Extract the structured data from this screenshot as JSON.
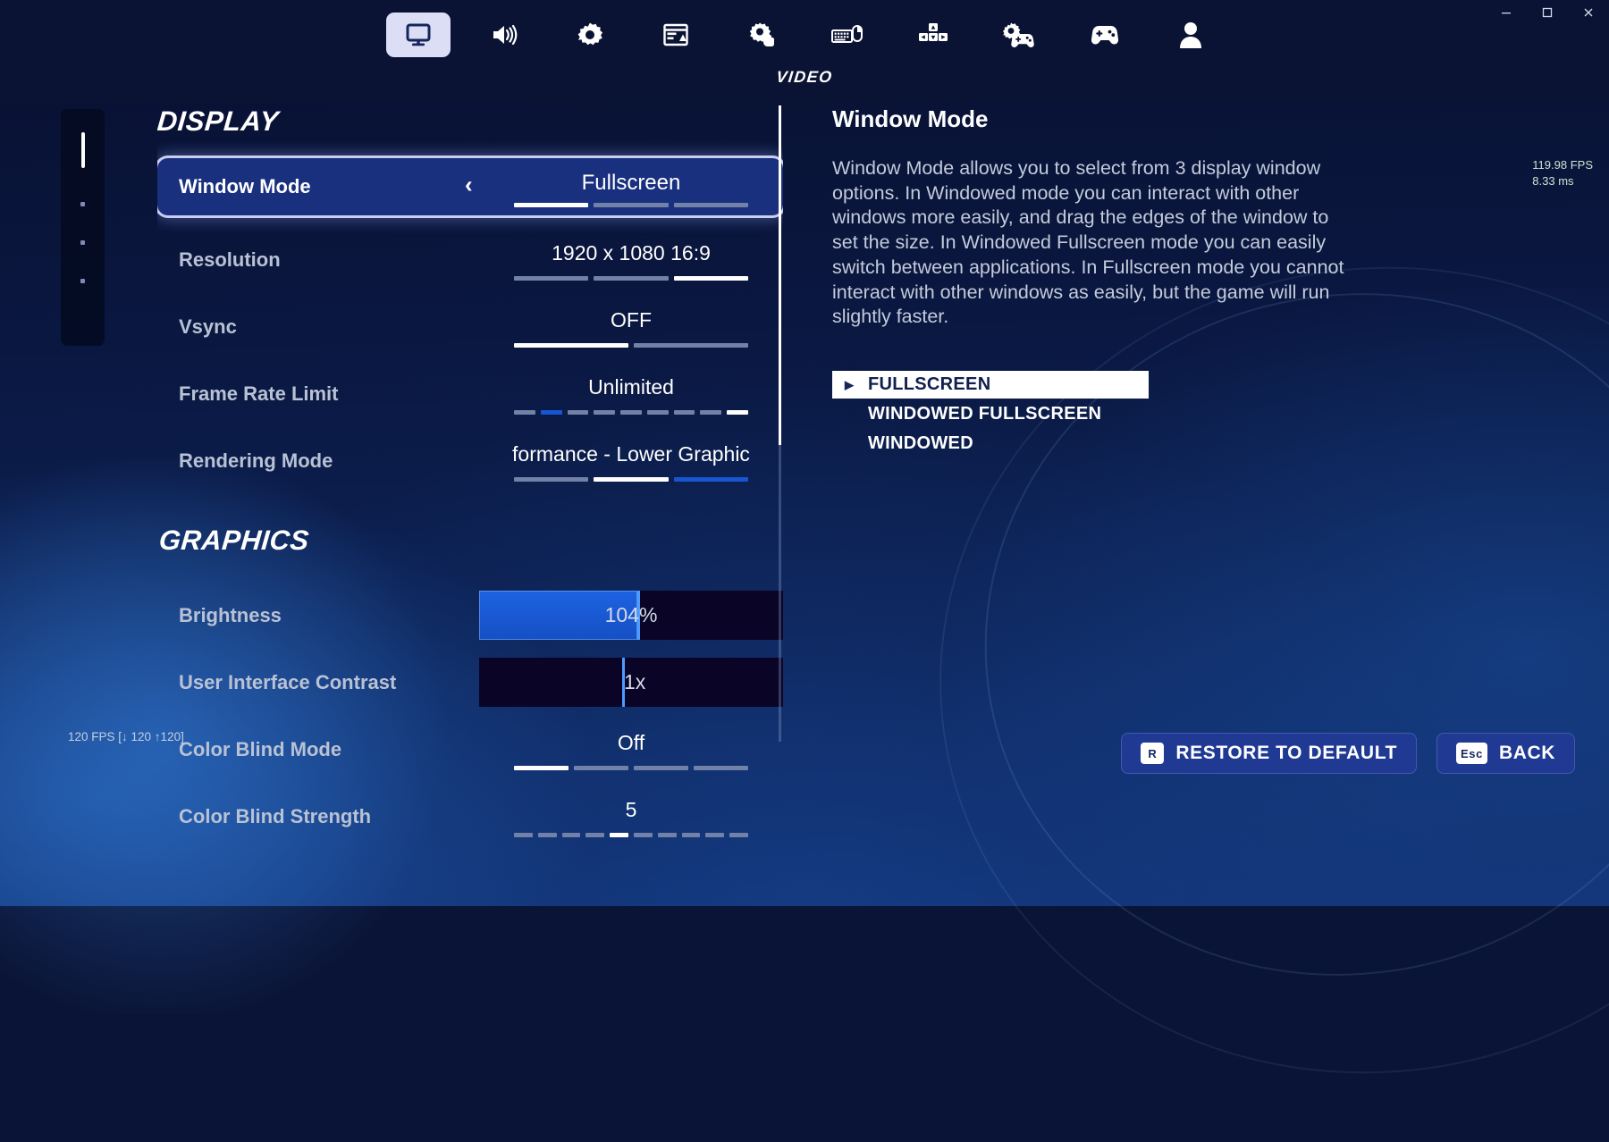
{
  "window_controls": {
    "minimize": "minimize",
    "maximize": "maximize",
    "close": "close"
  },
  "tabs": [
    {
      "icon": "monitor-icon",
      "name": "video",
      "active": true
    },
    {
      "icon": "speaker-icon",
      "name": "audio",
      "active": false
    },
    {
      "icon": "gear-icon",
      "name": "game",
      "active": false
    },
    {
      "icon": "hud-layout-icon",
      "name": "hud-layout",
      "active": false
    },
    {
      "icon": "accessibility-touch-icon",
      "name": "accessibility",
      "active": false
    },
    {
      "icon": "keyboard-mouse-icon",
      "name": "keyboard-mouse",
      "active": false
    },
    {
      "icon": "dpad-keys-icon",
      "name": "input-keys",
      "active": false
    },
    {
      "icon": "controller-gear-icon",
      "name": "controller-settings",
      "active": false
    },
    {
      "icon": "controller-icon",
      "name": "controller",
      "active": false
    },
    {
      "icon": "account-icon",
      "name": "account",
      "active": false
    }
  ],
  "active_tab_label": "VIDEO",
  "sections": [
    {
      "heading": "DISPLAY",
      "rows": [
        {
          "label": "Window Mode",
          "value": "Fullscreen",
          "type": "stepper",
          "selected": true,
          "segments": 3,
          "active_segment": 0,
          "left_arrow": "‹",
          "right_arrow": "›"
        },
        {
          "label": "Resolution",
          "value": "1920 x 1080 16:9",
          "type": "stepper",
          "selected": false,
          "segments": 3,
          "active_segment": 2
        },
        {
          "label": "Vsync",
          "value": "OFF",
          "type": "stepper",
          "selected": false,
          "segments": 2,
          "active_segment": 0
        },
        {
          "label": "Frame Rate Limit",
          "value": "Unlimited",
          "type": "stepper",
          "selected": false,
          "segments": 9,
          "active_segment": 1,
          "accent_segment": true
        },
        {
          "label": "Rendering Mode",
          "value": "formance - Lower Graphic",
          "type": "stepper",
          "selected": false,
          "segments": 3,
          "active_segment": 1,
          "accent_index": 2,
          "clipped": true
        }
      ]
    },
    {
      "heading": "GRAPHICS",
      "rows": [
        {
          "label": "Brightness",
          "value": "104%",
          "type": "slider",
          "fill_percent": 52,
          "handle_percent": 52
        },
        {
          "label": "User Interface Contrast",
          "value": "1x",
          "type": "slider",
          "fill_percent": 0,
          "handle_percent": 47
        },
        {
          "label": "Color Blind Mode",
          "value": "Off",
          "type": "stepper",
          "selected": false,
          "segments": 4,
          "active_segment": 0
        },
        {
          "label": "Color Blind Strength",
          "value": "5",
          "type": "stepper",
          "selected": false,
          "segments": 10,
          "active_segment": 4
        }
      ]
    }
  ],
  "info": {
    "title": "Window Mode",
    "description": "Window Mode allows you to select from 3 display window options. In Windowed mode you can interact with other windows more easily, and drag the edges of the window to set the size. In Windowed Fullscreen mode you can easily switch between applications. In Fullscreen mode you cannot interact with other windows as easily, but the game will run slightly faster.",
    "options": [
      {
        "label": "FULLSCREEN",
        "selected": true,
        "caret": "▶"
      },
      {
        "label": "WINDOWED FULLSCREEN",
        "selected": false
      },
      {
        "label": "WINDOWED",
        "selected": false
      }
    ]
  },
  "fps_overlay": {
    "fps": "119.98 FPS",
    "frametime": "8.33 ms"
  },
  "perf_readout": "120 FPS [↓ 120 ↑120]",
  "buttons": [
    {
      "key": "R",
      "label": "RESTORE TO DEFAULT",
      "name": "restore-to-default-button"
    },
    {
      "key": "Esc",
      "label": "BACK",
      "name": "back-button"
    }
  ],
  "colors": {
    "accent": "#1656d0",
    "selected_row": "#19307f",
    "selected_border": "#c9cdf0",
    "label": "#b9c2d4"
  }
}
